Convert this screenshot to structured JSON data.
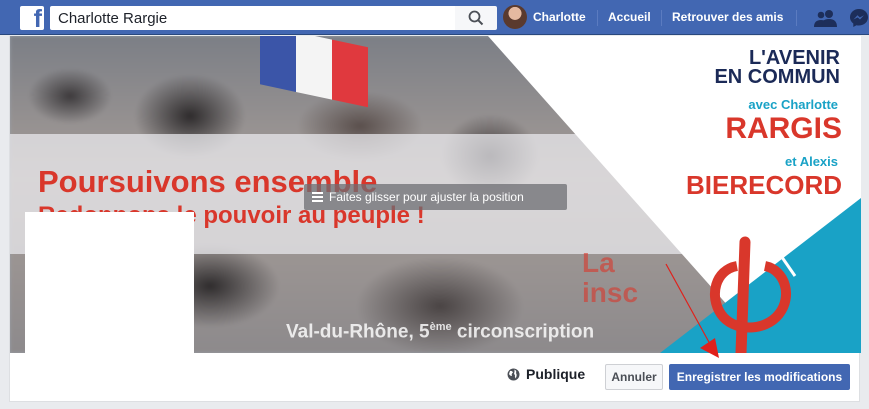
{
  "topbar": {
    "logo": "f",
    "search_value": "Charlotte Rargie",
    "search_icon": "search-icon",
    "profile_name": "Charlotte",
    "nav": [
      "Accueil",
      "Retrouver des amis"
    ],
    "friends_icon": "friends-icon",
    "messenger_icon": "messenger-icon"
  },
  "cover": {
    "slogan_line1": "Poursuivons ensemble",
    "slogan_line2": "Redonnons le pouvoir au peuple !",
    "drag_hint": "Faites glisser pour ajuster la position",
    "party_line1": "L'AVENIR",
    "party_line2": "EN COMMUN",
    "with_line": "avec Charlotte",
    "candidate1": "RARGIS",
    "and_line": "et Alexis",
    "candidate2": "BIERECORD",
    "constituency": "Val-du-Rhône, 5",
    "constituency_sup": "ème",
    "constituency_end": " circonscription",
    "side_text": "La insc"
  },
  "actions": {
    "privacy_icon": "globe-icon",
    "privacy_label": "Publique",
    "cancel_label": "Annuler",
    "save_label": "Enregistrer les modifications"
  },
  "colors": {
    "facebook_blue": "#4267b2",
    "slogan_red": "#d9372b",
    "party_navy": "#1b2a57",
    "cyan": "#19a2c6"
  }
}
